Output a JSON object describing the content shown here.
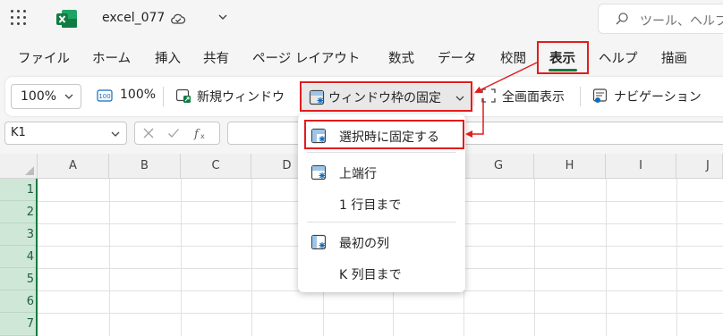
{
  "title_bar": {
    "file_name": "excel_077",
    "search_placeholder": "ツール、ヘルプ",
    "icons": [
      "app-launcher-icon",
      "excel-logo-icon",
      "saved-cloud-icon",
      "chevron-down-icon",
      "search-icon"
    ]
  },
  "tabs": [
    {
      "label": "ファイル"
    },
    {
      "label": "ホーム"
    },
    {
      "label": "挿入"
    },
    {
      "label": "共有"
    },
    {
      "label": "ページ レイアウト"
    },
    {
      "label": "数式"
    },
    {
      "label": "データ"
    },
    {
      "label": "校閲"
    },
    {
      "label": "表示",
      "selected": true
    },
    {
      "label": "ヘルプ"
    },
    {
      "label": "描画"
    }
  ],
  "ribbon": {
    "zoom_value": "100%",
    "zoom100_label": "100%",
    "new_window_label": "新規ウィンドウ",
    "freeze_panes_label": "ウィンドウ枠の固定",
    "fullscreen_label": "全画面表示",
    "navigation_label": "ナビゲーション"
  },
  "formula_bar": {
    "name_box_value": "K1",
    "formula_value": ""
  },
  "grid": {
    "columns": [
      "A",
      "B",
      "C",
      "D",
      "E",
      "F",
      "G",
      "H",
      "I",
      "J"
    ],
    "rows": [
      "1",
      "2",
      "3",
      "4",
      "5",
      "6",
      "7"
    ]
  },
  "freeze_menu": {
    "items": [
      {
        "label": "選択時に固定する",
        "icon": "freeze-selection-icon",
        "highlighted": true
      },
      {
        "label": "上端行",
        "icon": "freeze-top-row-icon"
      },
      {
        "label": "1 行目まで",
        "icon": ""
      },
      {
        "label": "最初の列",
        "icon": "freeze-first-column-icon"
      },
      {
        "label": "K 列目まで",
        "icon": ""
      }
    ]
  },
  "colors": {
    "accent_green": "#107c41",
    "annotation_red": "#e21c1c",
    "row_header_selected": "#cfe7d7"
  }
}
